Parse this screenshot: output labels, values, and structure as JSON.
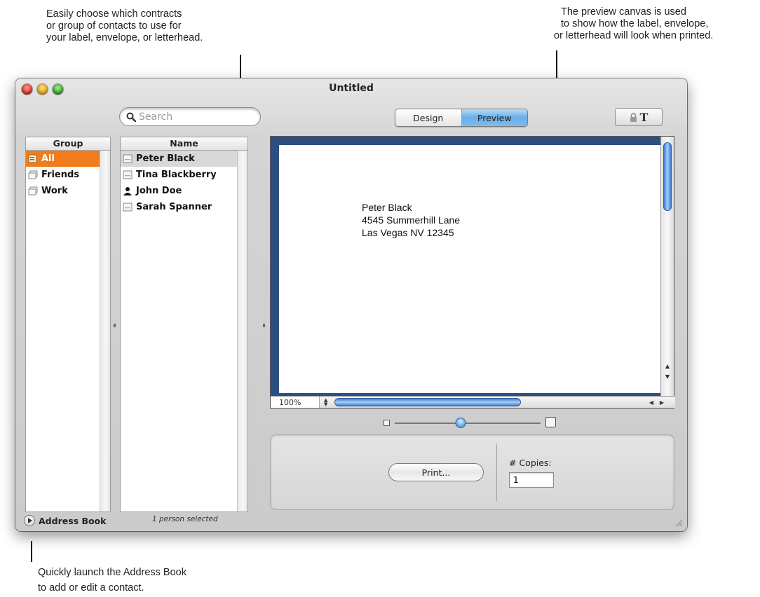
{
  "callouts": {
    "top_left": [
      "Easily choose which contracts",
      "or group of contacts to use for",
      "your label, envelope, or letterhead."
    ],
    "top_right": [
      "The preview canvas is used",
      "to show how the label, envelope,",
      "or letterhead will look when printed."
    ],
    "bottom_left": [
      "Quickly launch the Address Book",
      "to add or edit a contact."
    ]
  },
  "window": {
    "title": "Untitled"
  },
  "search": {
    "placeholder": "Search"
  },
  "view_toggle": {
    "design_label": "Design",
    "preview_label": "Preview",
    "selected": "Preview"
  },
  "toolbar": {
    "text_button_label": "T"
  },
  "groups": {
    "header": "Group",
    "items": [
      {
        "label": "All",
        "selected": true
      },
      {
        "label": "Friends",
        "selected": false
      },
      {
        "label": "Work",
        "selected": false
      }
    ]
  },
  "names": {
    "header": "Name",
    "items": [
      {
        "label": "Peter Black",
        "selected": true
      },
      {
        "label": "Tina Blackberry",
        "selected": false
      },
      {
        "label": "John Doe",
        "selected": false
      },
      {
        "label": "Sarah Spanner",
        "selected": false
      }
    ]
  },
  "bottom": {
    "address_book_label": "Address Book",
    "status": "1 person selected"
  },
  "preview": {
    "address_lines": [
      "Peter Black",
      "4545 Summerhill Lane",
      "Las Vegas NV 12345"
    ],
    "zoom": "100%",
    "slider_level": 0.45
  },
  "print": {
    "button_label": "Print...",
    "copies_label": "# Copies:",
    "copies_value": "1"
  },
  "colors": {
    "selection_orange": "#f27c1b",
    "preview_border_blue": "#2d4f80",
    "aqua_blue": "#5c9ddf"
  }
}
